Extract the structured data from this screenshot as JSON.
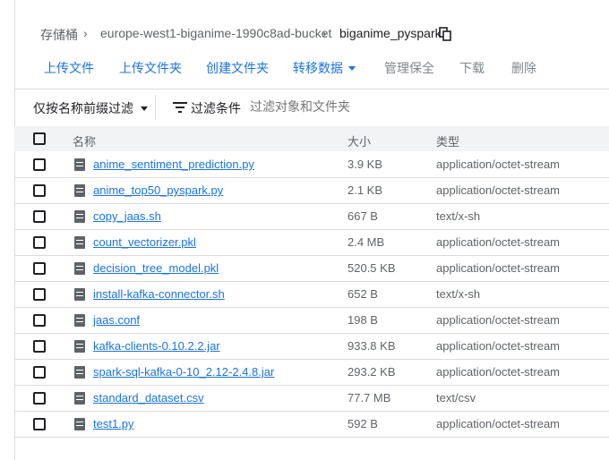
{
  "breadcrumb": {
    "root": "存储桶",
    "bucket": "europe-west1-biganime-1990c8ad-bucket",
    "folder": "biganime_pyspark"
  },
  "toolbar": {
    "upload_files": "上传文件",
    "upload_folder": "上传文件夹",
    "create_folder": "创建文件夹",
    "transfer_data": "转移数据",
    "manage_holds": "管理保全",
    "download": "下载",
    "delete": "删除"
  },
  "filter": {
    "prefix_dropdown": "仅按名称前缀过滤",
    "filter_button": "过滤条件",
    "placeholder": "过滤对象和文件夹"
  },
  "table": {
    "headers": {
      "name": "名称",
      "size": "大小",
      "type": "类型"
    },
    "rows": [
      {
        "name": "anime_sentiment_prediction.py",
        "size": "3.9 KB",
        "type": "application/octet-stream"
      },
      {
        "name": "anime_top50_pyspark.py",
        "size": "2.1 KB",
        "type": "application/octet-stream"
      },
      {
        "name": "copy_jaas.sh",
        "size": "667 B",
        "type": "text/x-sh"
      },
      {
        "name": "count_vectorizer.pkl",
        "size": "2.4 MB",
        "type": "application/octet-stream"
      },
      {
        "name": "decision_tree_model.pkl",
        "size": "520.5 KB",
        "type": "application/octet-stream"
      },
      {
        "name": "install-kafka-connector.sh",
        "size": "652 B",
        "type": "text/x-sh"
      },
      {
        "name": "jaas.conf",
        "size": "198 B",
        "type": "application/octet-stream"
      },
      {
        "name": "kafka-clients-0.10.2.2.jar",
        "size": "933.8 KB",
        "type": "application/octet-stream"
      },
      {
        "name": "spark-sql-kafka-0-10_2.12-2.4.8.jar",
        "size": "293.2 KB",
        "type": "application/octet-stream"
      },
      {
        "name": "standard_dataset.csv",
        "size": "77.7 MB",
        "type": "text/csv"
      },
      {
        "name": "test1.py",
        "size": "592 B",
        "type": "application/octet-stream"
      }
    ]
  },
  "icons": {
    "chevron": "chevron-right-icon",
    "copy": "copy-icon",
    "filter": "filter-icon",
    "file": "file-icon"
  }
}
